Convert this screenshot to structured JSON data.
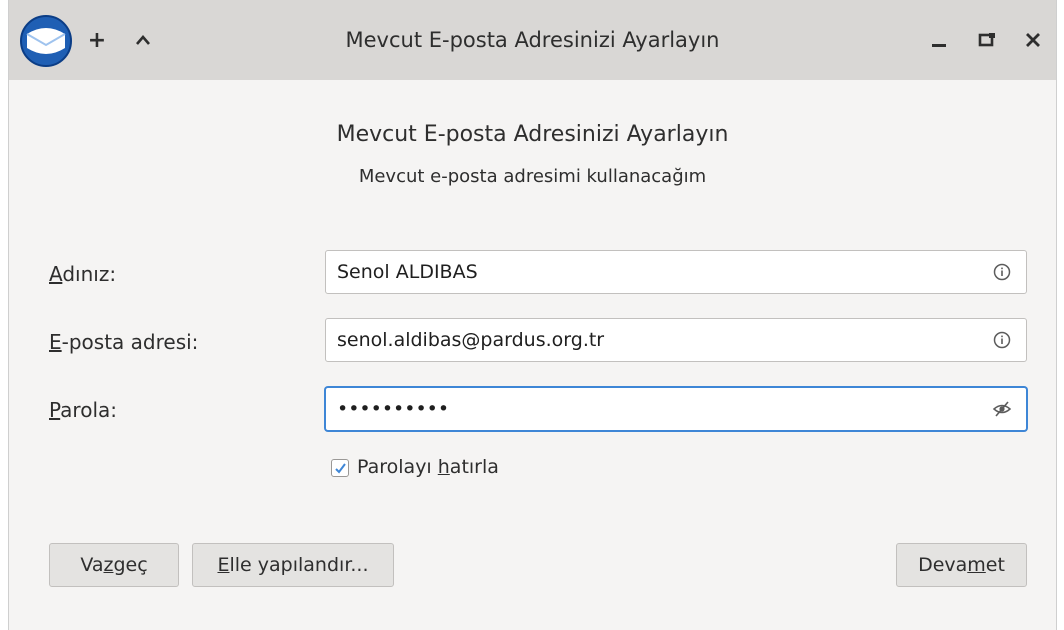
{
  "window": {
    "title": "Mevcut E-posta Adresinizi Ayarlayın",
    "buttons": {
      "add": "+",
      "shade": "^",
      "minimize": "_",
      "restore": "❐",
      "close": "✕"
    }
  },
  "dialog": {
    "heading": "Mevcut E-posta Adresinizi Ayarlayın",
    "subheading": "Mevcut e-posta adresimi kullanacağım"
  },
  "form": {
    "name": {
      "label_accel": "A",
      "label_rest": "dınız:",
      "value": "Senol ALDIBAS",
      "icon": "info-icon"
    },
    "email": {
      "label_accel": "E",
      "label_rest": "-posta adresi:",
      "value": "senol.aldibas@pardus.org.tr",
      "icon": "info-icon"
    },
    "password": {
      "label_accel": "P",
      "label_rest": "arola:",
      "value": "••••••••••",
      "icon": "eye-slash-icon"
    },
    "remember": {
      "checked": true,
      "text_before": "Parolayı ",
      "accel": "h",
      "text_after": "atırla"
    }
  },
  "buttons": {
    "cancel": {
      "before": "Va",
      "accel": "z",
      "after": "geç"
    },
    "manual": {
      "before": "",
      "accel": "E",
      "after": "lle yapılandır..."
    },
    "continue": {
      "before": "Deva",
      "accel": "m",
      "after": " et"
    }
  },
  "colors": {
    "accent": "#3e86d6",
    "titlebar": "#d9d7d5",
    "window_bg": "#f5f4f3"
  }
}
